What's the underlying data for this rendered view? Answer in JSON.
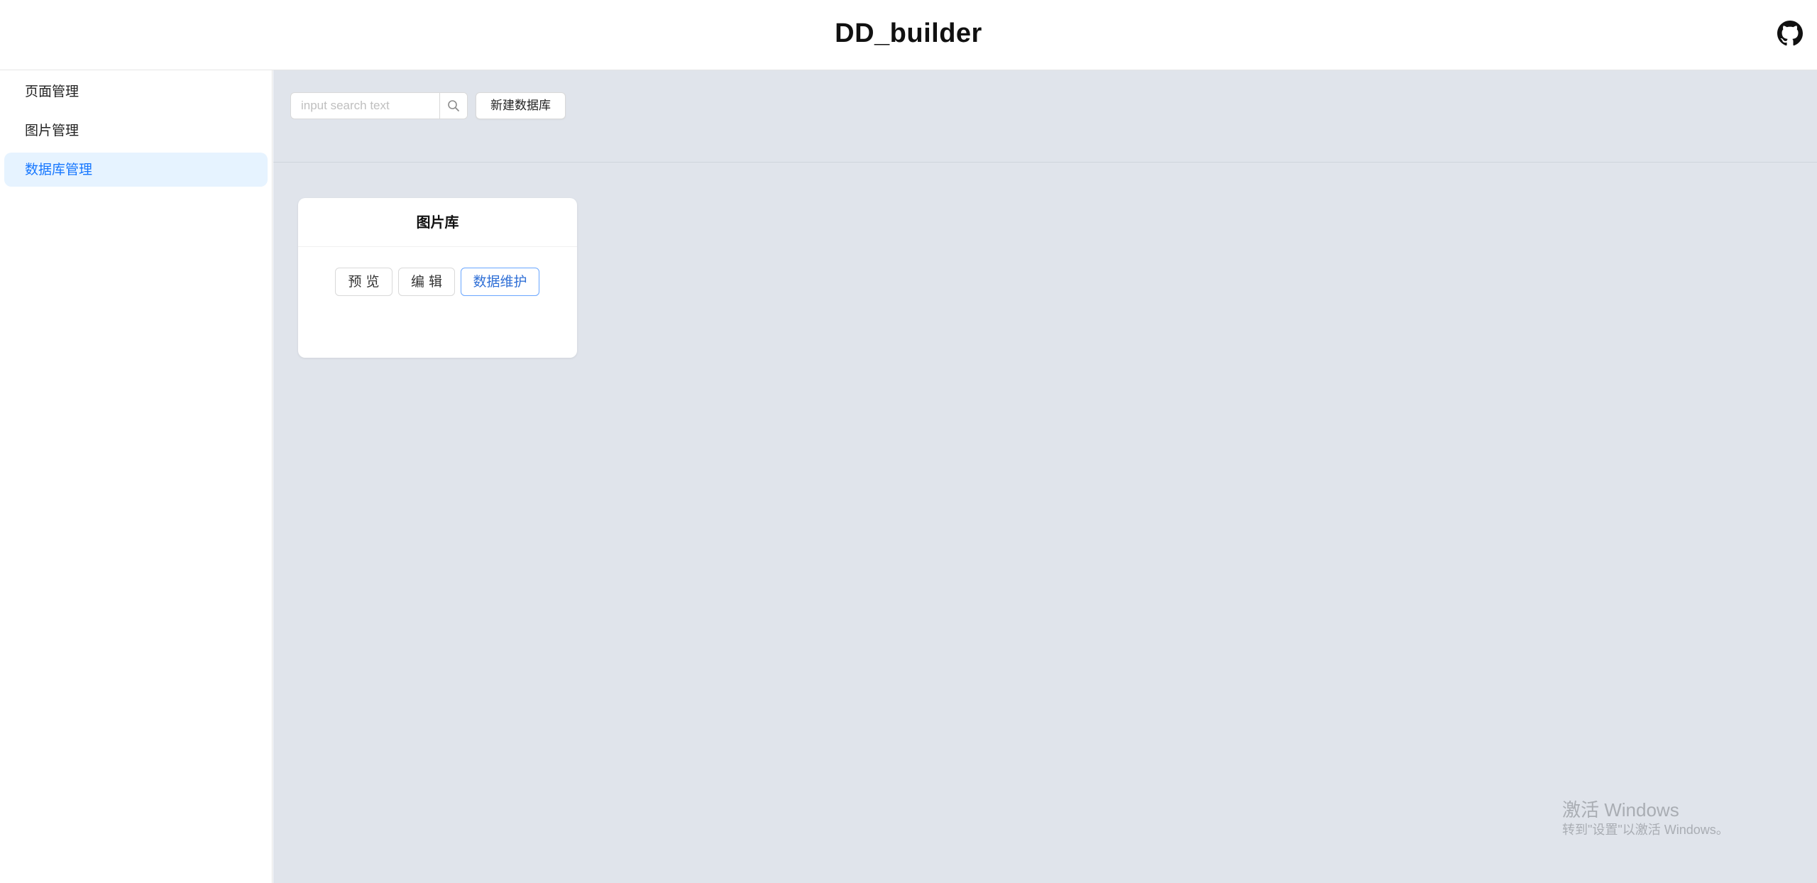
{
  "header": {
    "title": "DD_builder",
    "github_icon": "github-icon"
  },
  "sidebar": {
    "items": [
      {
        "label": "页面管理",
        "active": false
      },
      {
        "label": "图片管理",
        "active": false
      },
      {
        "label": "数据库管理",
        "active": true
      }
    ]
  },
  "toolbar": {
    "search_placeholder": "input search text",
    "search_value": "",
    "search_icon": "search-icon",
    "new_db_label": "新建数据库"
  },
  "cards": [
    {
      "title": "图片库",
      "buttons": {
        "preview": "预 览",
        "edit": "编 辑",
        "maintain": "数据维护"
      }
    }
  ],
  "watermark": {
    "title": "激活 Windows",
    "subtitle": "转到\"设置\"以激活 Windows。"
  },
  "colors": {
    "accent": "#1677ff",
    "active_bg": "#e6f3ff",
    "main_bg": "#e0e4eb"
  }
}
